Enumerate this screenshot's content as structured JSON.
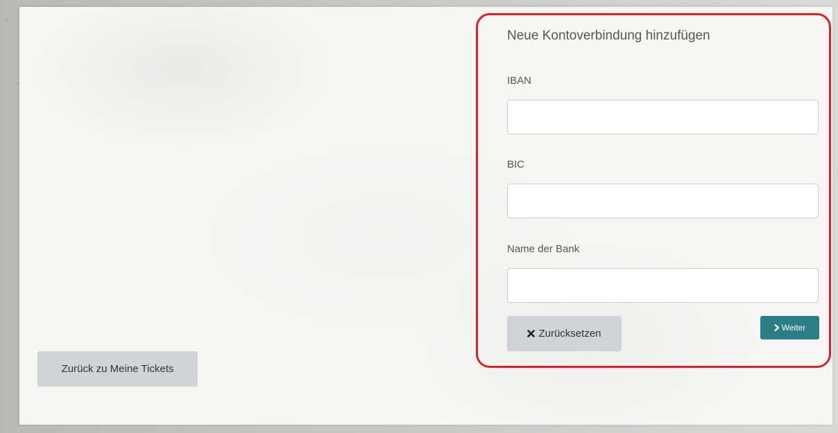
{
  "form": {
    "title": "Neue Kontoverbindung hinzufügen",
    "fields": [
      {
        "label": "IBAN",
        "value": "",
        "placeholder": ""
      },
      {
        "label": "BIC",
        "value": "",
        "placeholder": ""
      },
      {
        "label": "Name der Bank",
        "value": "",
        "placeholder": ""
      }
    ],
    "reset_label": "Zurücksetzen",
    "next_label": "Weiter"
  },
  "back_button_label": "Zurück zu Meine Tickets",
  "icons": {
    "reset": "times-icon",
    "next": "chevron-right-icon"
  },
  "colors": {
    "highlight_border": "#d9202b",
    "next_button": "#2b7d86",
    "secondary_button": "#d1d4d7"
  }
}
